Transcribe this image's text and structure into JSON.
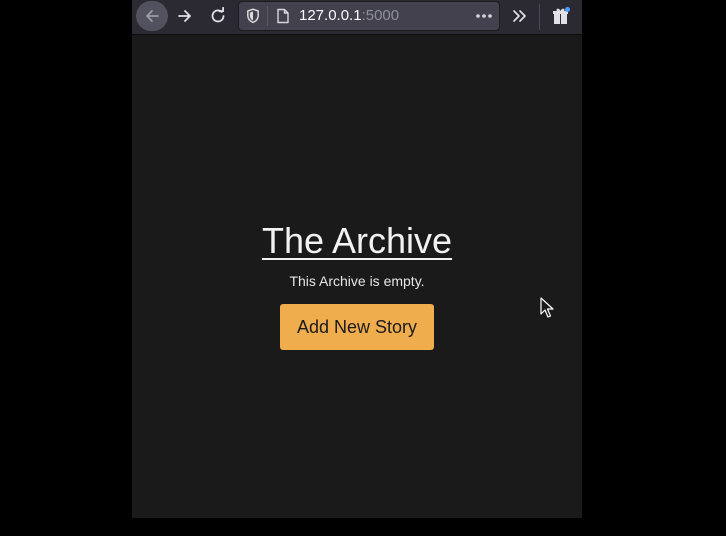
{
  "browser": {
    "url_host": "127.0.0.1",
    "url_port": ":5000",
    "url_more": "•••",
    "icons": {
      "back": "back-arrow-icon",
      "forward": "forward-arrow-icon",
      "reload": "reload-icon",
      "shield": "tracking-shield-icon",
      "page": "page-icon",
      "overflow": "chevron-double-right-icon",
      "extensions": "extensions-icon"
    }
  },
  "page": {
    "title": "The Archive",
    "empty_message": "This Archive is empty.",
    "add_button_label": "Add New Story"
  },
  "colors": {
    "page_background": "#1a1a1a",
    "button_background": "#efad4d",
    "title_color": "#f2f2f2",
    "toolbar_background": "#2b2a33"
  }
}
